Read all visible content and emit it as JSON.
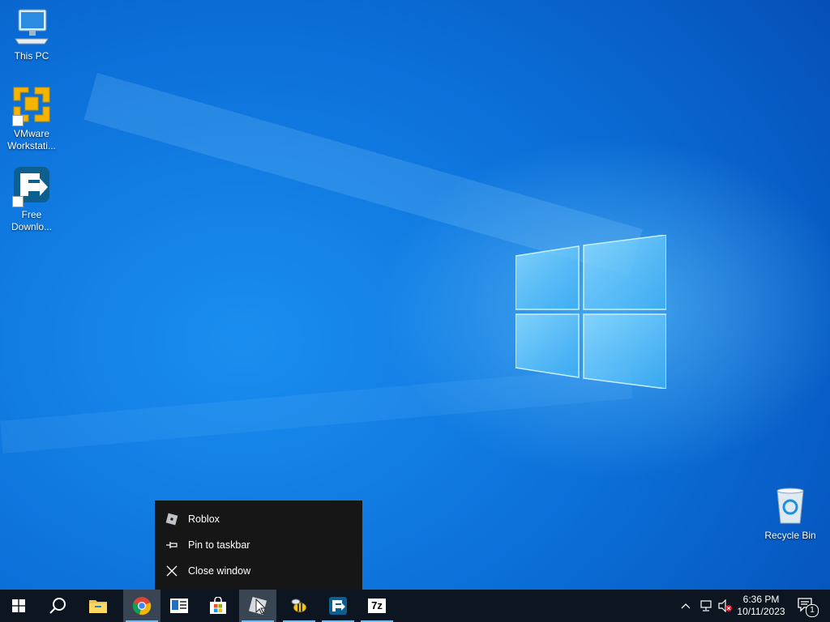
{
  "desktop": {
    "icons": [
      {
        "label": "This PC",
        "icon": "computer-icon"
      },
      {
        "label": "VMware Workstati...",
        "icon": "vmware-icon"
      },
      {
        "label": "Free Downlo...",
        "icon": "free-download-manager-icon"
      },
      {
        "label": "Recycle Bin",
        "icon": "recycle-bin-icon"
      }
    ]
  },
  "context_menu": {
    "items": [
      {
        "label": "Roblox",
        "icon": "roblox-icon"
      },
      {
        "label": "Pin to taskbar",
        "icon": "pin-icon"
      },
      {
        "label": "Close window",
        "icon": "close-icon"
      }
    ]
  },
  "taskbar": {
    "buttons": [
      {
        "icon": "windows-start-icon"
      },
      {
        "icon": "search-icon"
      },
      {
        "icon": "file-explorer-icon"
      },
      {
        "icon": "chrome-icon"
      },
      {
        "icon": "news-icon"
      },
      {
        "icon": "microsoft-store-icon"
      },
      {
        "icon": "roblox-icon"
      },
      {
        "icon": "bee-app-icon"
      },
      {
        "icon": "free-download-manager-icon"
      },
      {
        "icon": "7zip-icon",
        "label": "7z"
      }
    ],
    "tray": {
      "time": "6:36 PM",
      "date": "10/11/2023",
      "notification_count": "1"
    }
  },
  "colors": {
    "accent": "#76b9ed",
    "taskbar": "#0d1620",
    "menu": "#161616"
  }
}
